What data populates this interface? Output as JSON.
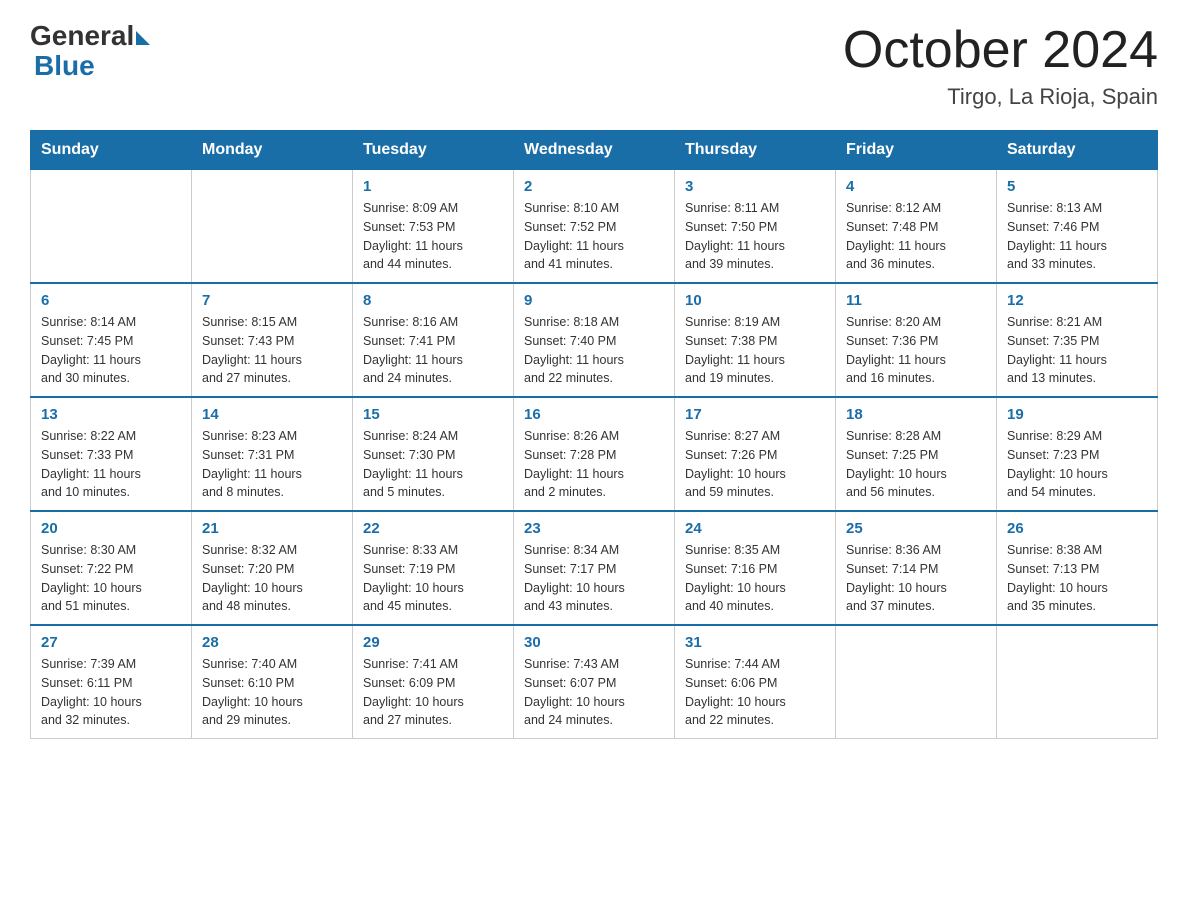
{
  "logo": {
    "general": "General",
    "blue": "Blue"
  },
  "title": "October 2024",
  "location": "Tirgo, La Rioja, Spain",
  "weekdays": [
    "Sunday",
    "Monday",
    "Tuesday",
    "Wednesday",
    "Thursday",
    "Friday",
    "Saturday"
  ],
  "weeks": [
    [
      {
        "day": "",
        "info": ""
      },
      {
        "day": "",
        "info": ""
      },
      {
        "day": "1",
        "info": "Sunrise: 8:09 AM\nSunset: 7:53 PM\nDaylight: 11 hours\nand 44 minutes."
      },
      {
        "day": "2",
        "info": "Sunrise: 8:10 AM\nSunset: 7:52 PM\nDaylight: 11 hours\nand 41 minutes."
      },
      {
        "day": "3",
        "info": "Sunrise: 8:11 AM\nSunset: 7:50 PM\nDaylight: 11 hours\nand 39 minutes."
      },
      {
        "day": "4",
        "info": "Sunrise: 8:12 AM\nSunset: 7:48 PM\nDaylight: 11 hours\nand 36 minutes."
      },
      {
        "day": "5",
        "info": "Sunrise: 8:13 AM\nSunset: 7:46 PM\nDaylight: 11 hours\nand 33 minutes."
      }
    ],
    [
      {
        "day": "6",
        "info": "Sunrise: 8:14 AM\nSunset: 7:45 PM\nDaylight: 11 hours\nand 30 minutes."
      },
      {
        "day": "7",
        "info": "Sunrise: 8:15 AM\nSunset: 7:43 PM\nDaylight: 11 hours\nand 27 minutes."
      },
      {
        "day": "8",
        "info": "Sunrise: 8:16 AM\nSunset: 7:41 PM\nDaylight: 11 hours\nand 24 minutes."
      },
      {
        "day": "9",
        "info": "Sunrise: 8:18 AM\nSunset: 7:40 PM\nDaylight: 11 hours\nand 22 minutes."
      },
      {
        "day": "10",
        "info": "Sunrise: 8:19 AM\nSunset: 7:38 PM\nDaylight: 11 hours\nand 19 minutes."
      },
      {
        "day": "11",
        "info": "Sunrise: 8:20 AM\nSunset: 7:36 PM\nDaylight: 11 hours\nand 16 minutes."
      },
      {
        "day": "12",
        "info": "Sunrise: 8:21 AM\nSunset: 7:35 PM\nDaylight: 11 hours\nand 13 minutes."
      }
    ],
    [
      {
        "day": "13",
        "info": "Sunrise: 8:22 AM\nSunset: 7:33 PM\nDaylight: 11 hours\nand 10 minutes."
      },
      {
        "day": "14",
        "info": "Sunrise: 8:23 AM\nSunset: 7:31 PM\nDaylight: 11 hours\nand 8 minutes."
      },
      {
        "day": "15",
        "info": "Sunrise: 8:24 AM\nSunset: 7:30 PM\nDaylight: 11 hours\nand 5 minutes."
      },
      {
        "day": "16",
        "info": "Sunrise: 8:26 AM\nSunset: 7:28 PM\nDaylight: 11 hours\nand 2 minutes."
      },
      {
        "day": "17",
        "info": "Sunrise: 8:27 AM\nSunset: 7:26 PM\nDaylight: 10 hours\nand 59 minutes."
      },
      {
        "day": "18",
        "info": "Sunrise: 8:28 AM\nSunset: 7:25 PM\nDaylight: 10 hours\nand 56 minutes."
      },
      {
        "day": "19",
        "info": "Sunrise: 8:29 AM\nSunset: 7:23 PM\nDaylight: 10 hours\nand 54 minutes."
      }
    ],
    [
      {
        "day": "20",
        "info": "Sunrise: 8:30 AM\nSunset: 7:22 PM\nDaylight: 10 hours\nand 51 minutes."
      },
      {
        "day": "21",
        "info": "Sunrise: 8:32 AM\nSunset: 7:20 PM\nDaylight: 10 hours\nand 48 minutes."
      },
      {
        "day": "22",
        "info": "Sunrise: 8:33 AM\nSunset: 7:19 PM\nDaylight: 10 hours\nand 45 minutes."
      },
      {
        "day": "23",
        "info": "Sunrise: 8:34 AM\nSunset: 7:17 PM\nDaylight: 10 hours\nand 43 minutes."
      },
      {
        "day": "24",
        "info": "Sunrise: 8:35 AM\nSunset: 7:16 PM\nDaylight: 10 hours\nand 40 minutes."
      },
      {
        "day": "25",
        "info": "Sunrise: 8:36 AM\nSunset: 7:14 PM\nDaylight: 10 hours\nand 37 minutes."
      },
      {
        "day": "26",
        "info": "Sunrise: 8:38 AM\nSunset: 7:13 PM\nDaylight: 10 hours\nand 35 minutes."
      }
    ],
    [
      {
        "day": "27",
        "info": "Sunrise: 7:39 AM\nSunset: 6:11 PM\nDaylight: 10 hours\nand 32 minutes."
      },
      {
        "day": "28",
        "info": "Sunrise: 7:40 AM\nSunset: 6:10 PM\nDaylight: 10 hours\nand 29 minutes."
      },
      {
        "day": "29",
        "info": "Sunrise: 7:41 AM\nSunset: 6:09 PM\nDaylight: 10 hours\nand 27 minutes."
      },
      {
        "day": "30",
        "info": "Sunrise: 7:43 AM\nSunset: 6:07 PM\nDaylight: 10 hours\nand 24 minutes."
      },
      {
        "day": "31",
        "info": "Sunrise: 7:44 AM\nSunset: 6:06 PM\nDaylight: 10 hours\nand 22 minutes."
      },
      {
        "day": "",
        "info": ""
      },
      {
        "day": "",
        "info": ""
      }
    ]
  ]
}
